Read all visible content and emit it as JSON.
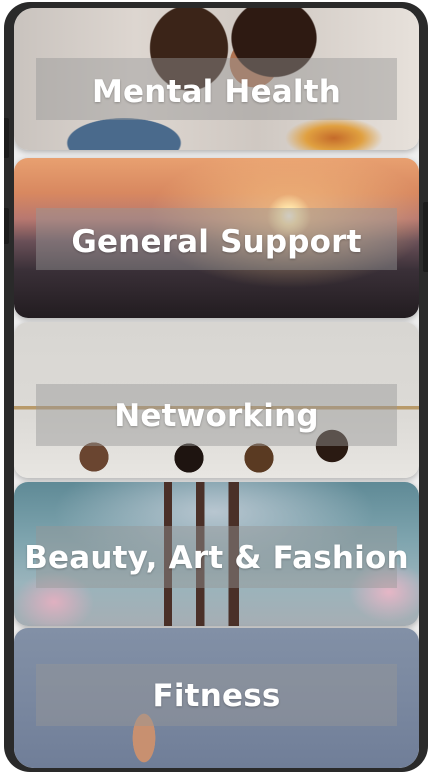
{
  "categories": [
    {
      "label": "Mental Health"
    },
    {
      "label": "General Support"
    },
    {
      "label": "Networking"
    },
    {
      "label": "Beauty, Art & Fashion"
    },
    {
      "label": "Fitness"
    }
  ]
}
